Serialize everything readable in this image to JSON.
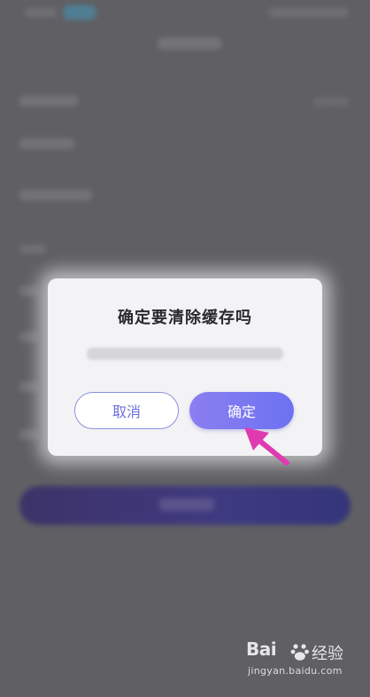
{
  "dialog": {
    "title": "确定要清除缓存吗",
    "cancel_label": "取消",
    "confirm_label": "确定"
  },
  "watermark": {
    "logo_prefix": "Bai",
    "logo_suffix": "经验",
    "url": "jingyan.baidu.com"
  },
  "icons": {
    "annotation_arrow": "arrow-icon",
    "watermark_paw": "paw-icon"
  },
  "colors": {
    "accent_start": "#8b7ef0",
    "accent_end": "#6d72f2",
    "cancel_text": "#6c70d8",
    "annotation_arrow": "#e03ab0"
  }
}
